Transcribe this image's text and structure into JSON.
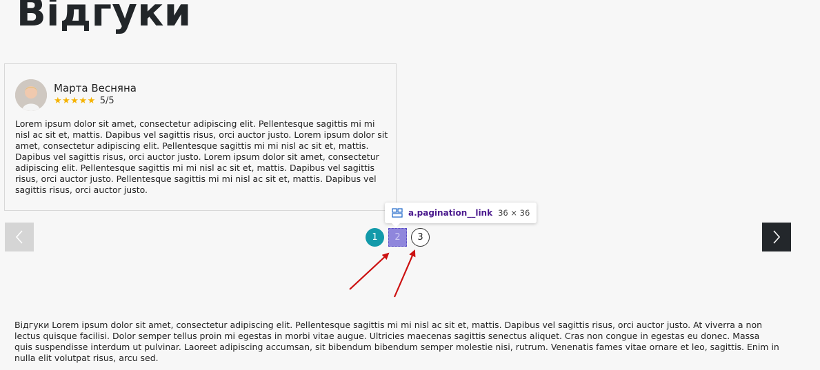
{
  "page": {
    "title": "Відгуки"
  },
  "review": {
    "name": "Марта Весняна",
    "stars": "★★★★★",
    "rating": "5/5",
    "text": "Lorem ipsum dolor sit amet, consectetur adipiscing elit. Pellentesque sagittis mi mi nisl ac sit et, mattis. Dapibus vel sagittis risus, orci auctor justo.  Lorem ipsum dolor sit amet, consectetur adipiscing elit. Pellentesque sagittis mi mi nisl ac sit et, mattis. Dapibus vel sagittis risus, orci auctor justo. Lorem ipsum dolor sit amet, consectetur adipiscing elit. Pellentesque sagittis mi mi nisl ac sit et, mattis. Dapibus vel sagittis risus, orci auctor justo. Pellentesque sagittis mi mi nisl ac sit et, mattis. Dapibus vel sagittis risus, orci auctor justo."
  },
  "pagination": {
    "pages": [
      "1",
      "2",
      "3"
    ],
    "active": 1,
    "highlighted": 2
  },
  "tooltip": {
    "selector": "a.pagination__link",
    "size": "36 × 36"
  },
  "footer": {
    "text": "Відгуки Lorem ipsum dolor sit amet, consectetur adipiscing elit. Pellentesque sagittis mi mi nisl ac sit et, mattis. Dapibus vel sagittis risus, orci auctor justo. At viverra a non lectus quisque facilisi. Dolor semper tellus proin mi egestas in morbi vitae augue. Ultricies maecenas sagittis senectus aliquet. Cras non congue in egestas eu donec. Massa quis suspendisse interdum ut pulvinar. Laoreet adipiscing accumsan, sit bibendum bibendum semper molestie nisi, rutrum. Venenatis fames vitae ornare et leo, sagittis. Enim in nulla elit volutpat risus, arcu sed."
  },
  "colors": {
    "page_bg": "#f7f7f7",
    "active_page": "#139aaa",
    "inspector_highlight": "#8f86dc",
    "next_button": "#23272b",
    "prev_button": "#d5d5d5",
    "star": "#f5b301",
    "annotation_arrow": "#cc1111"
  },
  "icons": {
    "prev": "chevron-left-icon",
    "next": "chevron-right-icon",
    "tooltip": "flex-layout-icon"
  }
}
